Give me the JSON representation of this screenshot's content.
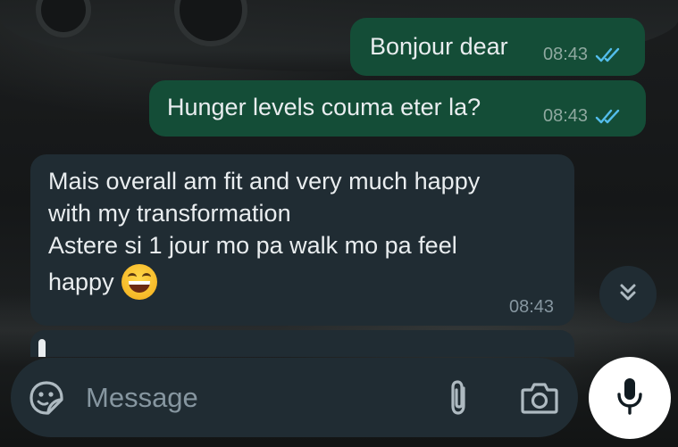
{
  "messages": [
    {
      "direction": "outgoing",
      "text": "Bonjour dear",
      "time": "08:43",
      "status": "read"
    },
    {
      "direction": "outgoing",
      "text": "Hunger levels couma eter la?",
      "time": "08:43",
      "status": "read"
    },
    {
      "direction": "incoming",
      "lines": [
        "Mais overall am fit and very much happy",
        "with my transformation",
        "Astere si 1 jour mo pa walk mo pa feel",
        "happy"
      ],
      "emoji": "grinning-squinting-face",
      "time": "08:43"
    }
  ],
  "composer": {
    "placeholder": "Message",
    "icons": [
      "sticker-icon",
      "paperclip-icon",
      "camera-icon"
    ]
  },
  "actions": {
    "scroll_down_icon": "double-chevron-down-icon",
    "mic_icon": "microphone-icon"
  },
  "colors": {
    "outgoing_bubble": "#144d37",
    "incoming_bubble": "#202c33",
    "read_ticks": "#53bdeb",
    "text": "#e9edef",
    "meta": "#8696a0"
  }
}
